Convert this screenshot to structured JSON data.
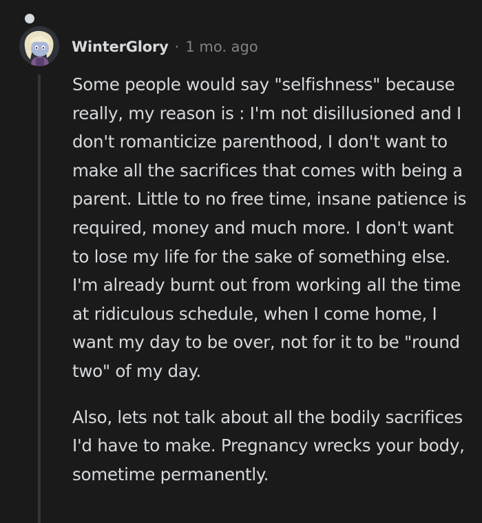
{
  "comment": {
    "avatar_icon": "user-avatar-icon",
    "username": "WinterGlory",
    "separator": "·",
    "timestamp": "1 mo. ago",
    "paragraphs": [
      "Some people would say \"selfishness\" because really, my reason is : I'm not disillusioned and I don't romanticize parenthood, I don't want to make all the sacrifices that comes with being a parent. Little to no free time, insane patience is required, money and much more. I don't want to lose my life for the sake of something else. I'm already burnt out from working all the time at ridiculous schedule, when I come home, I want my day to be over, not for it to be \"round two\" of my day.",
      "Also, lets not talk about all the bodily sacrifices I'd have to make. Pregnancy wrecks your body, sometime permanently."
    ]
  },
  "colors": {
    "background": "#1a1a1b",
    "text": "#d7dadc",
    "meta_text": "#818384",
    "thread_line": "#343536"
  }
}
